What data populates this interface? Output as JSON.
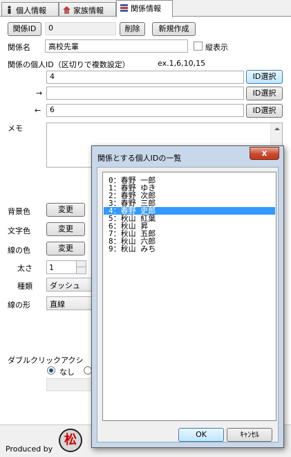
{
  "tabs": [
    {
      "label": "個人情報",
      "icon": "person-icon"
    },
    {
      "label": "家族情報",
      "icon": "house-icon"
    },
    {
      "label": "関係情報",
      "icon": "relation-icon"
    }
  ],
  "relation": {
    "id_button": "関係ID",
    "id_value": "0",
    "delete_button": "削除",
    "new_button": "新規作成",
    "name_label": "関係名",
    "name_value": "高校先輩",
    "vertical_label": "縦表示",
    "person_ids_label": "関係の個人ID（区切りで複数設定）",
    "example_text": "ex.1,6,10,15",
    "id_field_1": "4",
    "arrow_right": "→",
    "id_field_2": "",
    "arrow_left": "←",
    "id_field_3": "6",
    "id_select_button": "ID選択",
    "memo_label": "メモ",
    "memo_value": "",
    "bg_color_label": "背景色",
    "text_color_label": "文字色",
    "line_color_label": "線の色",
    "change_button": "変更",
    "thickness_label": "太さ",
    "thickness_value": "1",
    "type_label": "種類",
    "type_value": "ダッシュ",
    "line_shape_label": "線の形",
    "line_shape_value": "直線",
    "dblclick_label": "ダブルクリックアクシ",
    "radio_none_label": "なし"
  },
  "footer": {
    "produced_by": "Produced by",
    "logo_char": "松"
  },
  "dialog": {
    "title": "関係とする個人IDの一覧",
    "close": "x",
    "items": [
      "0：春野 一郎",
      "1：春野 ゆき",
      "2：春野 次郎",
      "3：春野 三郎",
      "4：春野 史郎",
      "5：秋山 紅葉",
      "6：秋山 昇",
      "7：秋山 五郎",
      "8：秋山 六郎",
      "9：秋山 みち"
    ],
    "selected_index": 4,
    "ok_button": "OK",
    "cancel_button": "ｷｬﾝｾﾙ"
  }
}
